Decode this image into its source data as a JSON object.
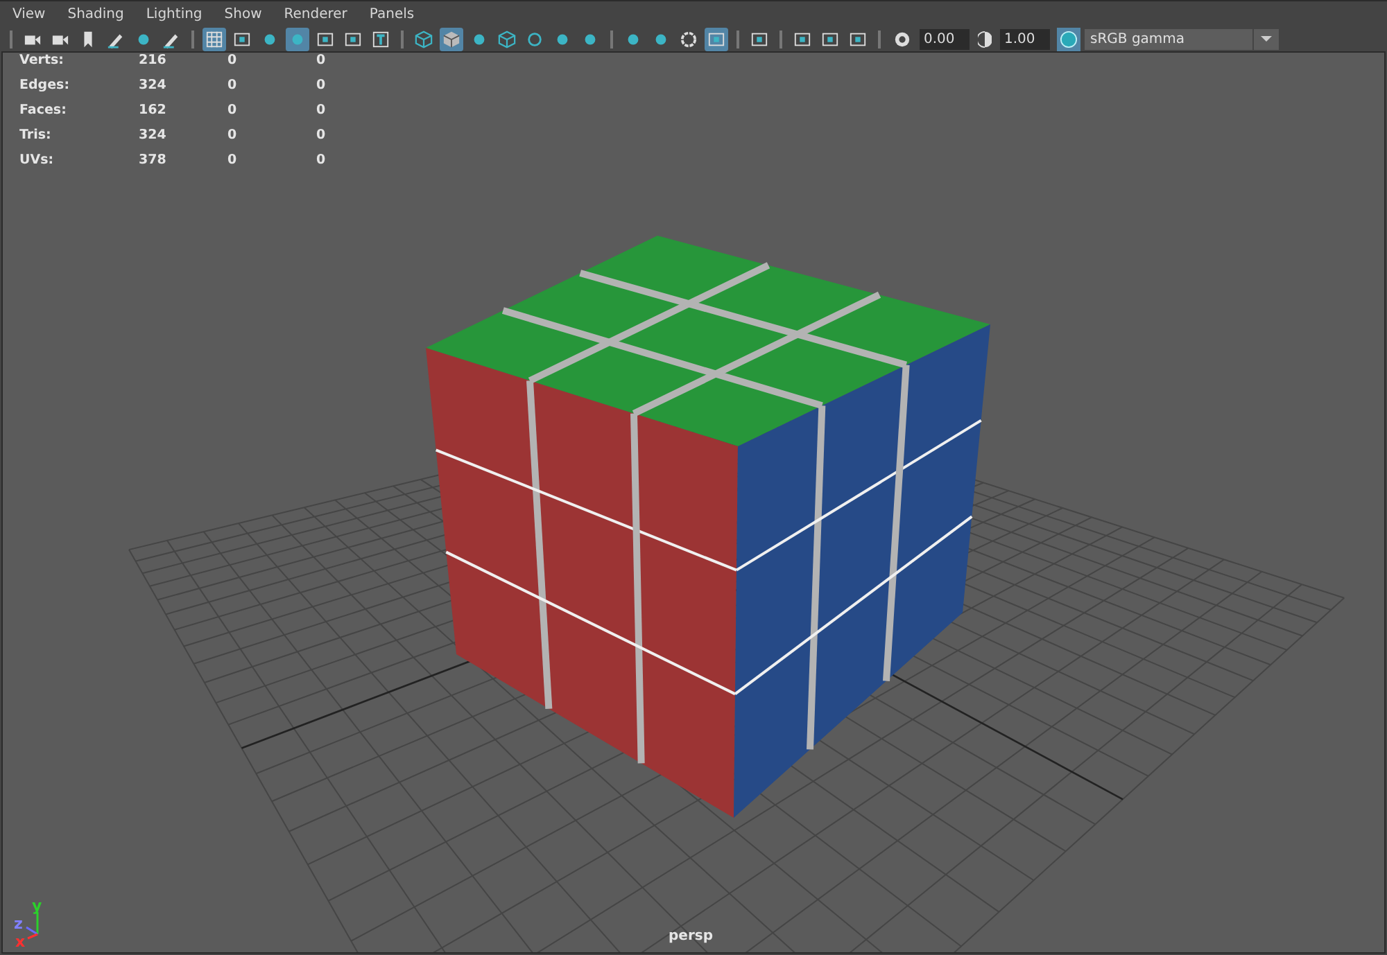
{
  "menu": [
    "View",
    "Shading",
    "Lighting",
    "Show",
    "Renderer",
    "Panels"
  ],
  "toolbar": {
    "groups": [
      {
        "items": [
          {
            "selected": false
          },
          {
            "selected": false
          },
          {
            "selected": false
          },
          {
            "selected": false
          },
          {
            "selected": false
          },
          {
            "selected": false
          }
        ]
      },
      {
        "items": [
          {
            "selected": true
          },
          {
            "selected": false
          },
          {
            "selected": false
          },
          {
            "selected": true
          },
          {
            "selected": false
          },
          {
            "selected": false
          },
          {
            "selected": false
          }
        ]
      },
      {
        "items": [
          {
            "selected": false
          },
          {
            "selected": true
          },
          {
            "selected": false
          },
          {
            "selected": false
          },
          {
            "selected": false
          },
          {
            "selected": false
          },
          {
            "selected": false
          }
        ]
      },
      {
        "items": [
          {
            "selected": false
          },
          {
            "selected": false
          },
          {
            "selected": false
          },
          {
            "selected": true
          }
        ]
      },
      {
        "items": [
          {
            "selected": false
          }
        ]
      },
      {
        "items": [
          {
            "selected": false
          },
          {
            "selected": false
          },
          {
            "selected": false
          }
        ]
      }
    ],
    "exposure": "0.00",
    "gamma": "1.00",
    "color_management": {
      "selected": true
    },
    "color_space": "sRGB gamma"
  },
  "stats": [
    {
      "label": "Verts:",
      "values": [
        "216",
        "0",
        "0"
      ]
    },
    {
      "label": "Edges:",
      "values": [
        "324",
        "0",
        "0"
      ]
    },
    {
      "label": "Faces:",
      "values": [
        "162",
        "0",
        "0"
      ]
    },
    {
      "label": "Tris:",
      "values": [
        "324",
        "0",
        "0"
      ]
    },
    {
      "label": "UVs:",
      "values": [
        "378",
        "0",
        "0"
      ]
    }
  ],
  "axes": {
    "x": "x",
    "y": "y",
    "z": "z"
  },
  "camera_label": "persp"
}
